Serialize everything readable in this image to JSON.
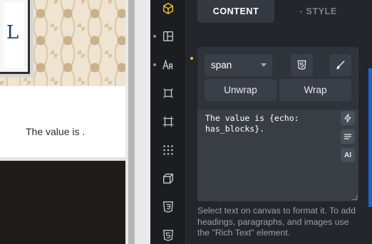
{
  "canvas": {
    "glyph": "L",
    "text": "The value is ."
  },
  "rail": {
    "icons": [
      "cube-icon",
      "layout-icon",
      "typography-icon",
      "component-icon",
      "frame-icon",
      "grid-dots-icon",
      "box-3d-icon",
      "css3-icon",
      "html5-icon"
    ]
  },
  "tabs": {
    "content": "CONTENT",
    "style_bullet": "•",
    "style": "STYLE"
  },
  "element": {
    "tag_selected": "span",
    "unwrap_label": "Unwrap",
    "wrap_label": "Wrap",
    "editor_value": "The value is {echo:\nhas_blocks}.",
    "ai_label": "AI"
  },
  "help_text": "Select text on canvas to format it. To add headings, paragraphs, and images use the \"Rich Text\" element.",
  "colors": {
    "panel_bg": "#23262b",
    "accent_marker": "#f2c230",
    "selection_edge": "#1f66c8"
  }
}
